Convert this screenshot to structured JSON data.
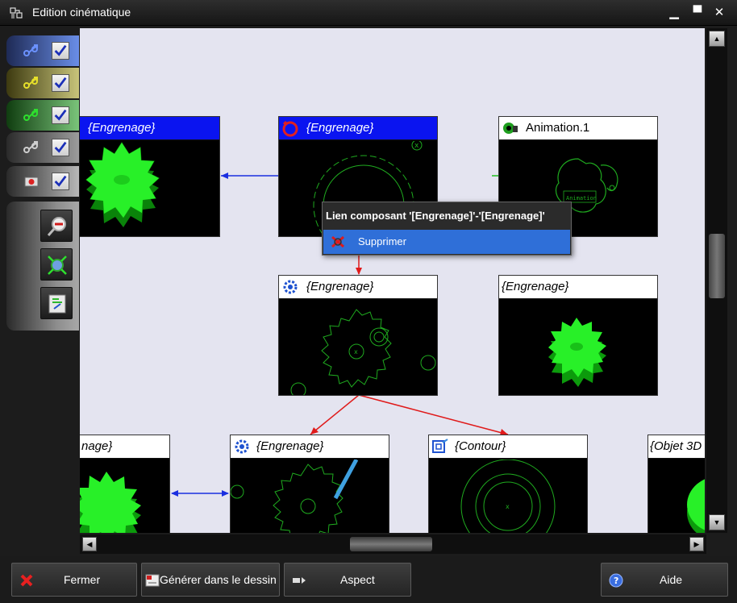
{
  "window": {
    "title": "Edition cinématique",
    "controls": {
      "minimize": "▁",
      "maximize": "▀",
      "close": "✕"
    }
  },
  "left_toolbar": {
    "filters": [
      {
        "icon": "link-blue-icon",
        "checked": true,
        "color": "#4d6fd9"
      },
      {
        "icon": "link-yellow-icon",
        "checked": true,
        "color": "#c8c02a"
      },
      {
        "icon": "link-green-icon",
        "checked": true,
        "color": "#2eb82e"
      },
      {
        "icon": "link-gray-icon",
        "checked": true,
        "color": "#9a9a9a"
      },
      {
        "icon": "component-icon",
        "checked": true,
        "color": "#b8b8b8"
      }
    ],
    "tools": [
      "zoom-out-icon",
      "zoom-fit-icon",
      "layout-icon"
    ]
  },
  "diagram": {
    "nodes": [
      {
        "id": "n1",
        "label": "{Engrenage}",
        "selected": true,
        "icon": "gear-icon",
        "preview": "solid-gear"
      },
      {
        "id": "n2",
        "label": "{Engrenage}",
        "selected": true,
        "icon": "rotation-icon",
        "preview": "wireframe-gear"
      },
      {
        "id": "n3",
        "label": "Animation.1",
        "selected": false,
        "icon": "animation-icon",
        "preview": "animation"
      },
      {
        "id": "n4",
        "label": "{Engrenage}",
        "selected": false,
        "icon": "gear-mechanism-icon",
        "preview": "wireframe-gear"
      },
      {
        "id": "n5",
        "label": "{Engrenage}",
        "selected": false,
        "icon": "",
        "preview": "solid-gear"
      },
      {
        "id": "n6",
        "label": "nage}",
        "selected": false,
        "icon": "",
        "preview": "solid-gear"
      },
      {
        "id": "n7",
        "label": "{Engrenage}",
        "selected": false,
        "icon": "gear-mechanism-icon",
        "preview": "wireframe-gear"
      },
      {
        "id": "n8",
        "label": "{Contour}",
        "selected": false,
        "icon": "contour-icon",
        "preview": "contour"
      },
      {
        "id": "n9",
        "label": "{Objet 3D",
        "selected": false,
        "icon": "",
        "preview": "solid-3d"
      }
    ],
    "link_colors": {
      "blue": "#1a2ee0",
      "red": "#e01a1a",
      "green": "#20c020"
    }
  },
  "context_menu": {
    "title": "Lien composant '[Engrenage]'-'[Engrenage]'",
    "items": [
      {
        "label": "Supprimer",
        "icon": "delete-link-icon"
      }
    ]
  },
  "buttons": {
    "close": "Fermer",
    "generate": "Générer dans le dessin",
    "aspect": "Aspect",
    "help": "Aide"
  }
}
